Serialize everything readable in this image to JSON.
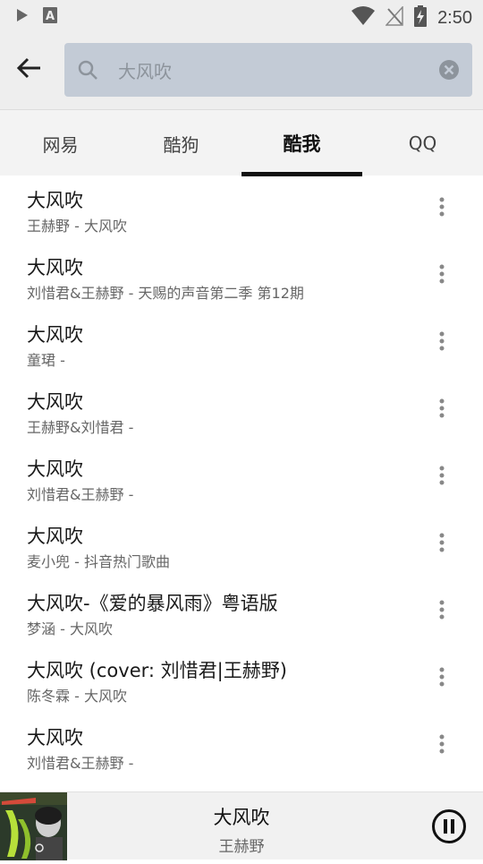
{
  "status_bar": {
    "time": "2:50",
    "icons": [
      "play-icon",
      "a-icon",
      "wifi-icon",
      "no-signal-icon",
      "battery-charging-icon"
    ]
  },
  "search": {
    "value": "大风吹",
    "placeholder": "大风吹"
  },
  "tabs": [
    {
      "label": "网易",
      "active": false
    },
    {
      "label": "酷狗",
      "active": false
    },
    {
      "label": "酷我",
      "active": true
    },
    {
      "label": "QQ",
      "active": false
    }
  ],
  "songs": [
    {
      "title": "大风吹",
      "subtitle": "王赫野 - 大风吹"
    },
    {
      "title": "大风吹",
      "subtitle": "刘惜君&王赫野 - 天赐的声音第二季 第12期"
    },
    {
      "title": "大风吹",
      "subtitle": "童珺 -"
    },
    {
      "title": "大风吹",
      "subtitle": "王赫野&刘惜君 -"
    },
    {
      "title": "大风吹",
      "subtitle": "刘惜君&王赫野 -"
    },
    {
      "title": "大风吹",
      "subtitle": "麦小兜 - 抖音热门歌曲"
    },
    {
      "title": "大风吹-《爱的暴风雨》粤语版",
      "subtitle": "梦涵 - 大风吹"
    },
    {
      "title": "大风吹 (cover: 刘惜君|王赫野)",
      "subtitle": "陈冬霖 - 大风吹"
    },
    {
      "title": "大风吹",
      "subtitle": "刘惜君&王赫野 -"
    }
  ],
  "player": {
    "title": "大风吹",
    "artist": "王赫野",
    "state": "playing"
  },
  "colors": {
    "top_bar": "#eeeeee",
    "search_box": "#c3cbd6",
    "tab_indicator": "#111111"
  }
}
